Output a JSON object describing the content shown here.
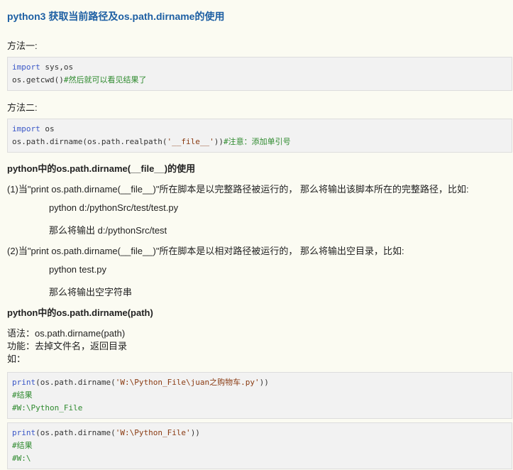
{
  "title": "python3 获取当前路径及os.path.dirname的使用",
  "method1_label": "方法一:",
  "code1": {
    "l1_kw": "import",
    "l1_rest": " sys,os",
    "l2_code": "os.getcwd()",
    "l2_comment": "#然后就可以看见结果了"
  },
  "method2_label": "方法二:",
  "code2": {
    "l1_kw": "import",
    "l1_rest": " os",
    "l2_a": "os.path.dirname(os.path.realpath(",
    "l2_str": "'__file__'",
    "l2_b": "))",
    "l2_comment": "#注意：添加单引号"
  },
  "heading1": "python中的os.path.dirname(__file__)的使用",
  "item1": "(1)当\"print os.path.dirname(__file__)\"所在脚本是以完整路径被运行的， 那么将输出该脚本所在的完整路径，比如:",
  "item1_ex1": "python d:/pythonSrc/test/test.py",
  "item1_ex2": "那么将输出 d:/pythonSrc/test",
  "item2": "(2)当\"print os.path.dirname(__file__)\"所在脚本是以相对路径被运行的， 那么将输出空目录，比如:",
  "item2_ex1": "python test.py",
  "item2_ex2": "那么将输出空字符串",
  "heading2": "python中的os.path.dirname(path)",
  "syntax": "语法：os.path.dirname(path)",
  "function": "功能：去掉文件名，返回目录",
  "example": "如：",
  "code3": {
    "l1_fn": "print",
    "l1_a": "(os.path.dirname(",
    "l1_str": "'W:\\Python_File\\juan之购物车.py'",
    "l1_b": "))",
    "l2_comment": "#结果",
    "l3_comment": "#W:\\Python_File"
  },
  "code4": {
    "l1_fn": "print",
    "l1_a": "(os.path.dirname(",
    "l1_str": "'W:\\Python_File'",
    "l1_b": "))",
    "l2_comment": "#结果",
    "l3_comment": "#W:\\"
  }
}
